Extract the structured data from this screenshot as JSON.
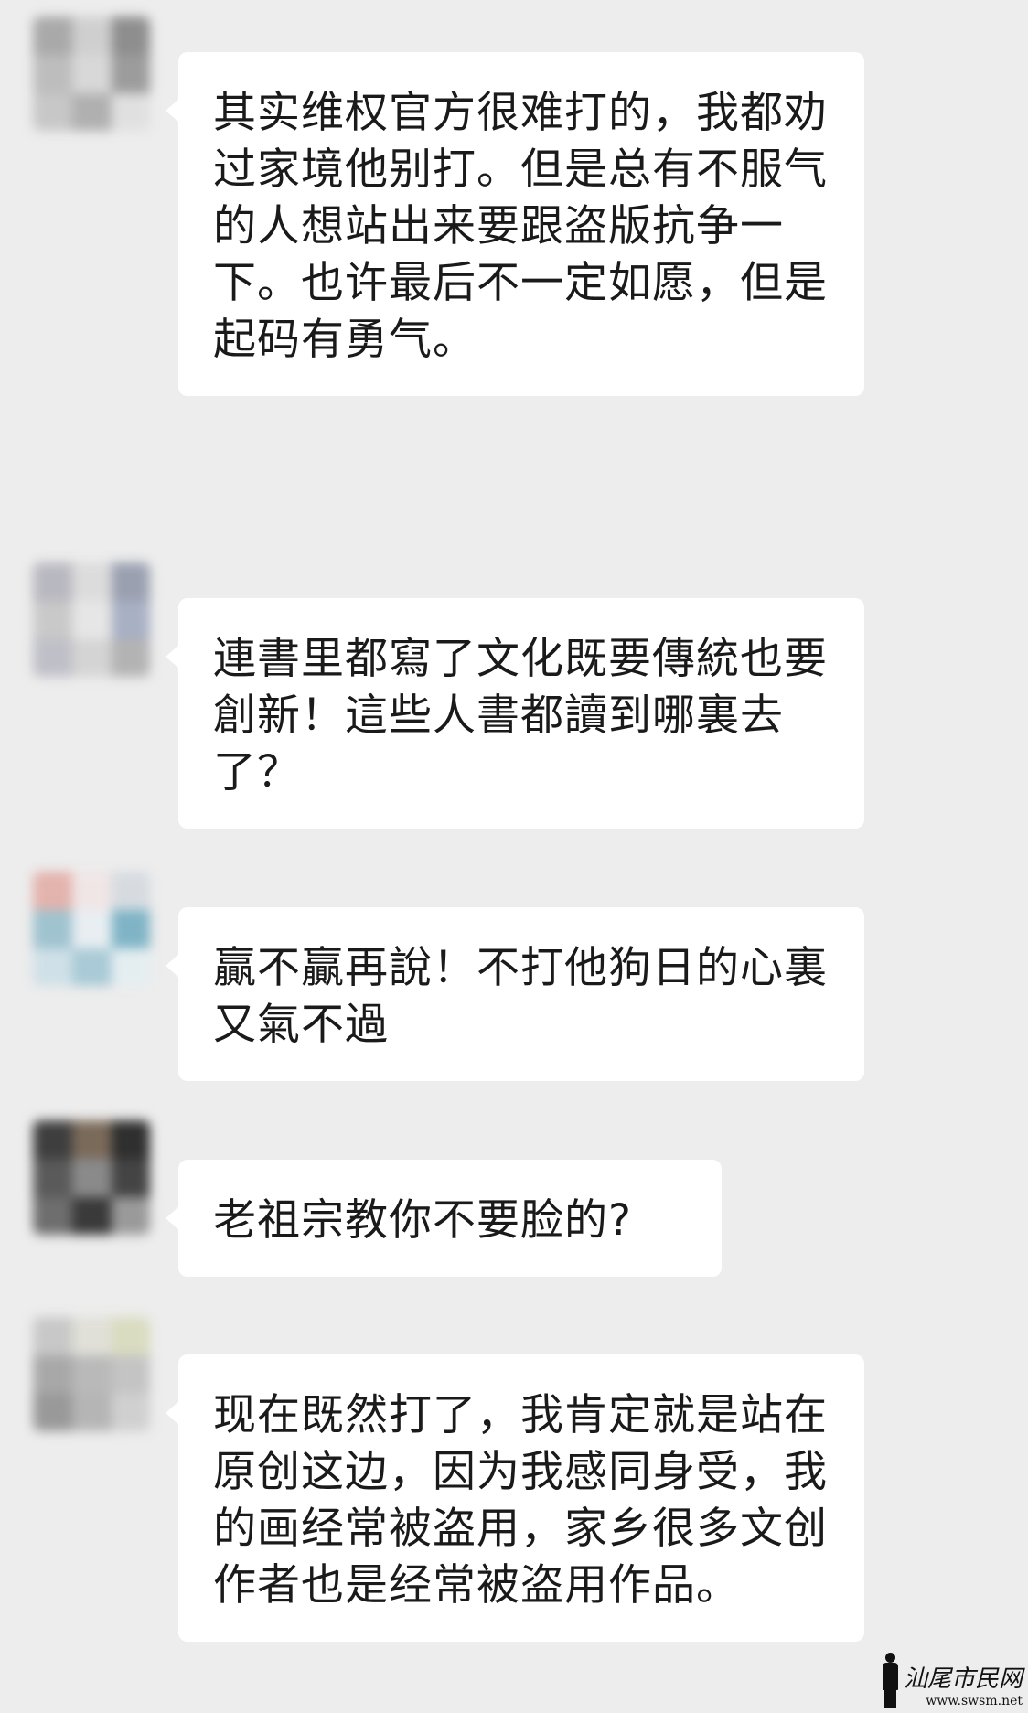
{
  "messages": [
    {
      "avatar_colors": [
        "#a9a9a9",
        "#cfcfcf",
        "#8e8e8e",
        "#bdbdbd",
        "#d8d8d8",
        "#9c9c9c",
        "#c7c7c7",
        "#b0b0b0",
        "#e0e0e0"
      ],
      "text": "其实维权官方很难打的，我都劝过家境他别打。但是总有不服气的人想站出来要跟盗版抗争一下。也许最后不一定如愿，但是起码有勇气。"
    },
    {
      "avatar_colors": [
        "#b8b8c0",
        "#dcdcdc",
        "#9aa0b0",
        "#c9c9c9",
        "#e6e6e6",
        "#a8b0c4",
        "#bfbfc8",
        "#d4d4d4",
        "#b3b3b3"
      ],
      "text": "連書里都寫了文化既要傳統也要創新！這些人書都讀到哪裏去了？"
    },
    {
      "avatar_colors": [
        "#e3b3ad",
        "#f0e6e6",
        "#d6dbe0",
        "#9fc3cf",
        "#e8eef2",
        "#7fb4c6",
        "#cfe0e8",
        "#a9cad6",
        "#e4eef1"
      ],
      "text": "贏不贏再說！不打他狗日的心裏又氣不過"
    },
    {
      "avatar_colors": [
        "#3e3e3e",
        "#7a6a5a",
        "#2f2f2f",
        "#5a5a5a",
        "#8a8a8a",
        "#444444",
        "#6e6e6e",
        "#3a3a3a",
        "#9a9a9a"
      ],
      "text": "老祖宗教你不要脸的?"
    },
    {
      "avatar_colors": [
        "#c8c8c8",
        "#e0e0d8",
        "#d9dcc0",
        "#a8a8a8",
        "#b9b9b9",
        "#c4c4c4",
        "#999999",
        "#b5b5b5",
        "#d0d0d0"
      ],
      "text": "现在既然打了，我肯定就是站在原创这边，因为我感同身受，我的画经常被盗用，家乡很多文创作者也是经常被盗用作品。"
    }
  ],
  "watermark": {
    "name": "汕尾市民网",
    "url": "www.swsm.net"
  }
}
